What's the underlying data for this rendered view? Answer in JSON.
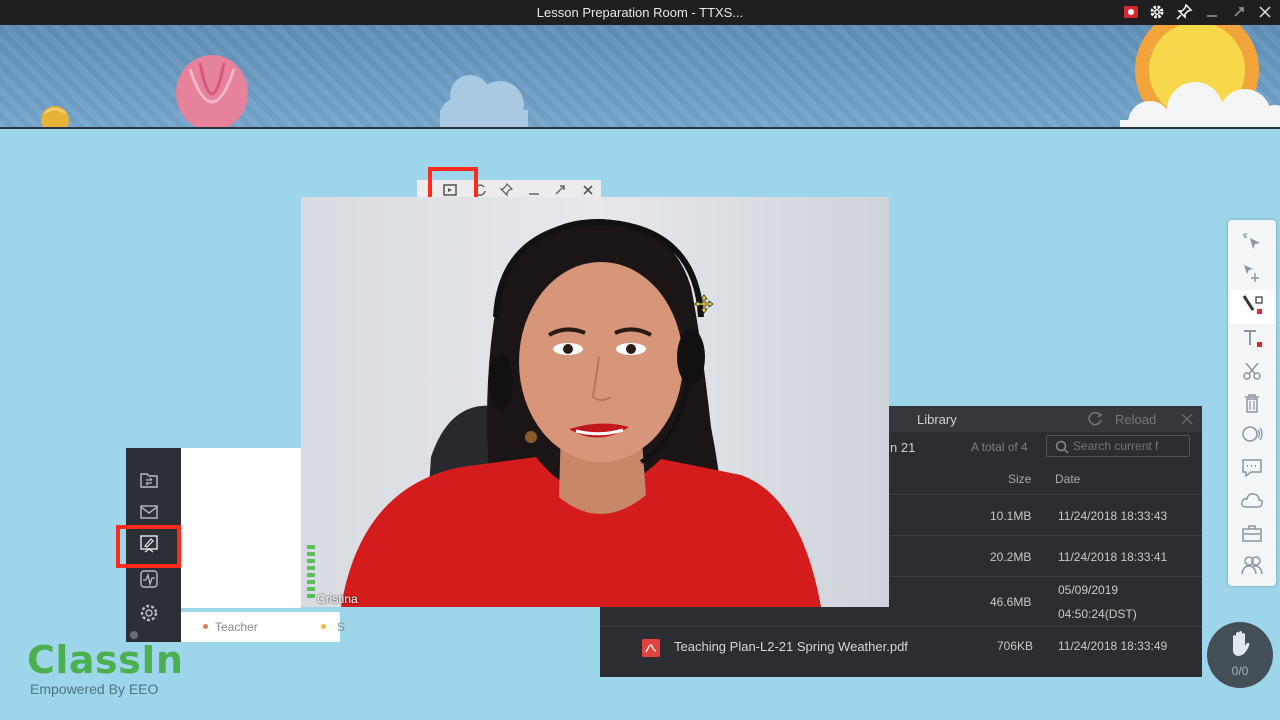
{
  "window": {
    "title": "Lesson Preparation Room - TTXS...",
    "controls": [
      "record-icon",
      "gear-icon",
      "pin-icon",
      "minimize-icon",
      "maximize-icon",
      "close-icon"
    ]
  },
  "video": {
    "participant_name": "Cristina",
    "toolbar_icons": [
      "screen-share-icon",
      "refresh-icon",
      "pin-icon",
      "minimize-icon",
      "expand-icon",
      "close-icon"
    ]
  },
  "left_toolbar": {
    "items": [
      "file-transfer-icon",
      "mail-icon",
      "whiteboard-icon",
      "activity-icon",
      "settings-icon"
    ]
  },
  "roles": {
    "teacher": "Teacher",
    "student": "S",
    "teacher_color": "#e07b5a",
    "student_color": "#f0b83a"
  },
  "library": {
    "title": "Library",
    "reload_label": "Reload",
    "folder_fragment": "n 21",
    "total": "A total of 4",
    "search_placeholder": "Search current f",
    "columns": {
      "size": "Size",
      "date": "Date"
    },
    "files": [
      {
        "name": "",
        "size": "10.1MB",
        "date": "11/24/2018 18:33:43",
        "date2": ""
      },
      {
        "name": "",
        "size": "20.2MB",
        "date": "11/24/2018 18:33:41",
        "date2": ""
      },
      {
        "name": "",
        "size": "46.6MB",
        "date": "05/09/2019",
        "date2": "04:50:24(DST)"
      },
      {
        "name": "Teaching Plan-L2-21 Spring Weather.pdf",
        "size": "706KB",
        "date": "11/24/2018 18:33:49",
        "date2": ""
      }
    ]
  },
  "right_toolbar": {
    "items": [
      "cursor-icon",
      "selector-icon",
      "pen-icon",
      "text-icon",
      "scissors-icon",
      "trash-icon",
      "camera-icon",
      "chat-icon",
      "cloud-icon",
      "toolbox-icon",
      "students-icon"
    ]
  },
  "hand_raise": {
    "count": "0/0"
  },
  "brand": {
    "logo": "ClassIn",
    "tagline": "Empowered By EEO",
    "logo_color": "#4caf50"
  }
}
